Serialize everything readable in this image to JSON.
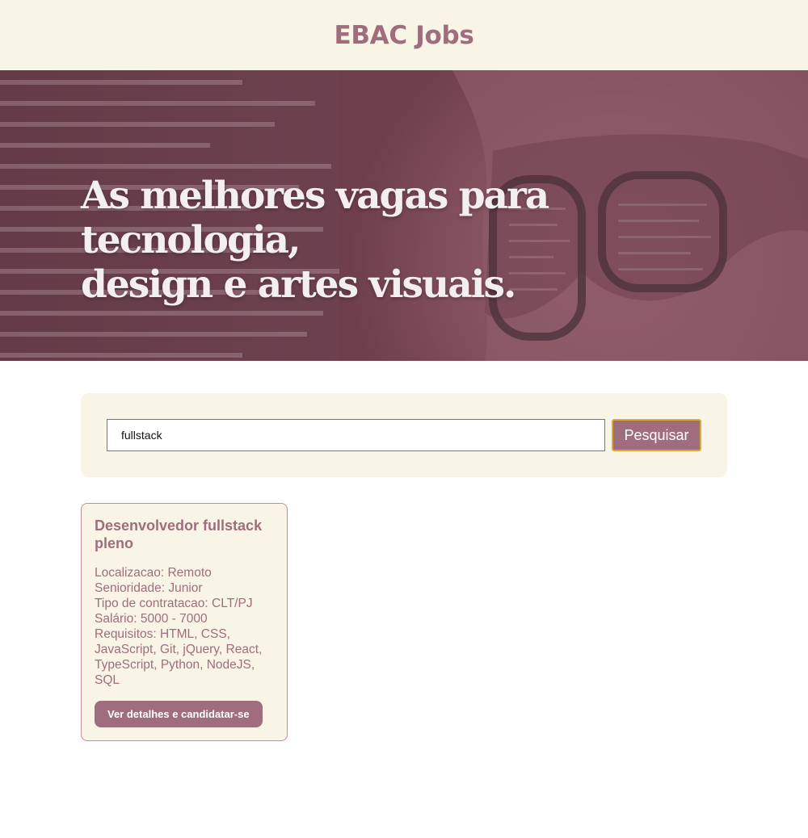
{
  "header": {
    "title": "EBAC Jobs"
  },
  "hero": {
    "title_line1": "As melhores vagas para tecnologia,",
    "title_line2": "design e artes visuais."
  },
  "search": {
    "value": "fullstack",
    "button_label": "Pesquisar"
  },
  "jobs": [
    {
      "title": "Desenvolvedor fullstack pleno",
      "location": "Localizacao: Remoto",
      "seniority": "Senioridade: Junior",
      "contract": "Tipo de contratacao: CLT/PJ",
      "salary": "Salário: 5000 - 7000",
      "requirements": "Requisitos: HTML, CSS, JavaScript, Git, jQuery, React, TypeScript, Python, NodeJS, SQL",
      "button_label": "Ver detalhes e candidatar-se"
    }
  ],
  "colors": {
    "accent": "#a06d7e",
    "cream": "#f8f4e6",
    "hero_overlay": "#7b4a59",
    "button_focus": "#e0a830"
  }
}
